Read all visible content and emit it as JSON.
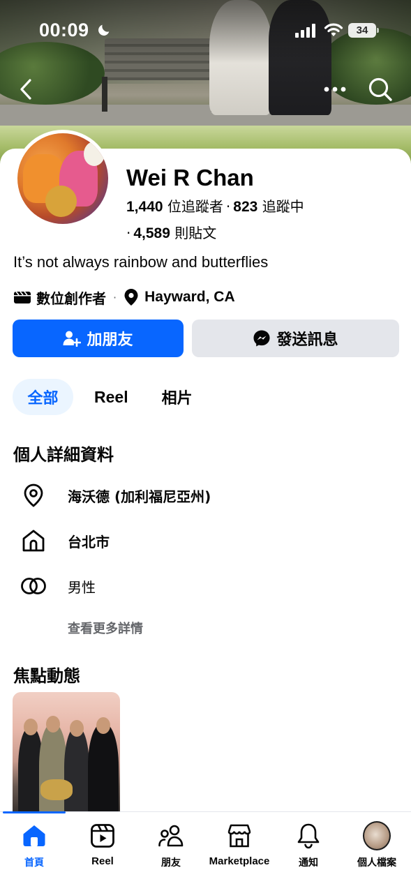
{
  "status_bar": {
    "time": "00:09",
    "battery": "34"
  },
  "profile": {
    "name": "Wei R Chan",
    "followers_count": "1,440",
    "followers_label": "位追蹤者",
    "following_count": "823",
    "following_label": "追蹤中",
    "posts_count": "4,589",
    "posts_label": "則貼文",
    "bio": "It’s not always rainbow and butterflies",
    "category": "數位創作者",
    "location": "Hayward, CA"
  },
  "actions": {
    "add_friend": "加朋友",
    "send_message": "發送訊息"
  },
  "tabs": [
    {
      "label": "全部",
      "active": true
    },
    {
      "label": "Reel",
      "active": false
    },
    {
      "label": "相片",
      "active": false
    }
  ],
  "details": {
    "title": "個人詳細資料",
    "items": [
      {
        "icon": "location-pin-icon",
        "text": "海沃德 (加利福尼亞州)"
      },
      {
        "icon": "home-icon",
        "text": "台北市"
      },
      {
        "icon": "gender-rings-icon",
        "text": "男性"
      }
    ],
    "see_more": "查看更多詳情"
  },
  "featured": {
    "title": "焦點動態"
  },
  "tabbar": {
    "items": [
      {
        "label": "首頁",
        "icon": "home-icon",
        "active": true
      },
      {
        "label": "Reel",
        "icon": "reel-icon",
        "active": false
      },
      {
        "label": "朋友",
        "icon": "friends-icon",
        "active": false
      },
      {
        "label": "Marketplace",
        "icon": "marketplace-icon",
        "active": false
      },
      {
        "label": "通知",
        "icon": "bell-icon",
        "active": false
      },
      {
        "label": "個人檔案",
        "icon": "profile-avatar",
        "active": false
      }
    ]
  },
  "colors": {
    "accent": "#0866ff",
    "secondary_button": "#e4e6eb",
    "muted_text": "#65676b",
    "tab_active_bg": "#ebf5ff"
  }
}
